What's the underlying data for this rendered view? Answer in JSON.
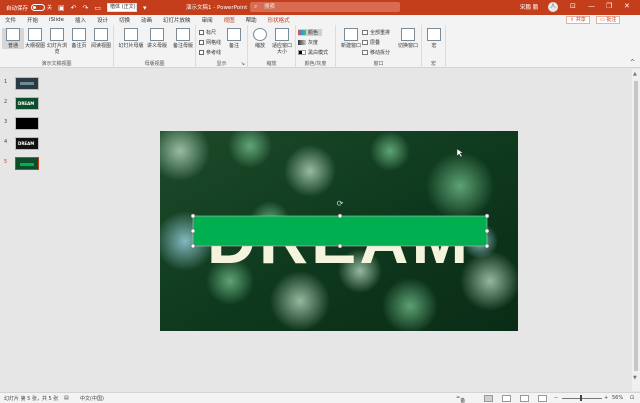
{
  "titlebar": {
    "autosave_label": "自动保存",
    "autosave_state": "关",
    "font_value": "楷体 (正文)",
    "doc_title": "演示文稿1 - PowerPoint",
    "search_placeholder": "搜索",
    "user_name": "宋鹏 鹏",
    "avatar": "人"
  },
  "tabs": [
    "文件",
    "开始",
    "iSlide",
    "插入",
    "设计",
    "切换",
    "动画",
    "幻灯片放映",
    "审阅",
    "视图",
    "帮助",
    "形状格式"
  ],
  "active_tab": "视图",
  "share_label": "共享",
  "comment_label": "批注",
  "ribbon": {
    "view_buttons": [
      "普通",
      "大纲视图",
      "幻灯片浏览",
      "备注页",
      "阅读视图"
    ],
    "view_group": "演示文稿视图",
    "master_buttons": [
      "幻灯片母版",
      "讲义母版",
      "备注母版"
    ],
    "master_group": "母版视图",
    "show_items": [
      "标尺",
      "网格线",
      "参考线"
    ],
    "show_group": "显示",
    "notes_label": "备注",
    "zoom_buttons": [
      "缩放",
      "适应窗口大小"
    ],
    "zoom_group": "缩放",
    "color_items": [
      "颜色",
      "灰度",
      "黑白模式"
    ],
    "color_group": "颜色/灰度",
    "window_new": "新建窗口",
    "window_items": [
      "全部重排",
      "层叠",
      "移动拆分"
    ],
    "window_switch": "切换窗口",
    "window_group": "窗口",
    "macro_label": "宏",
    "macro_group": "宏"
  },
  "thumbnails": [
    {
      "num": "1",
      "kind": "dark"
    },
    {
      "num": "2",
      "kind": "green-text",
      "text": "DREAM"
    },
    {
      "num": "3",
      "kind": "black"
    },
    {
      "num": "4",
      "kind": "dark-text",
      "text": "DREAM"
    },
    {
      "num": "5",
      "kind": "green-bar",
      "current": true
    }
  ],
  "slide": {
    "word": "DREAM",
    "bar_color": "#00B050",
    "bg_color": "#0b3a1f"
  },
  "status": {
    "slide_info": "幻灯片 第 5 张，共 5 张",
    "language": "中文(中国)",
    "notes": "备注",
    "zoom": "56%"
  }
}
